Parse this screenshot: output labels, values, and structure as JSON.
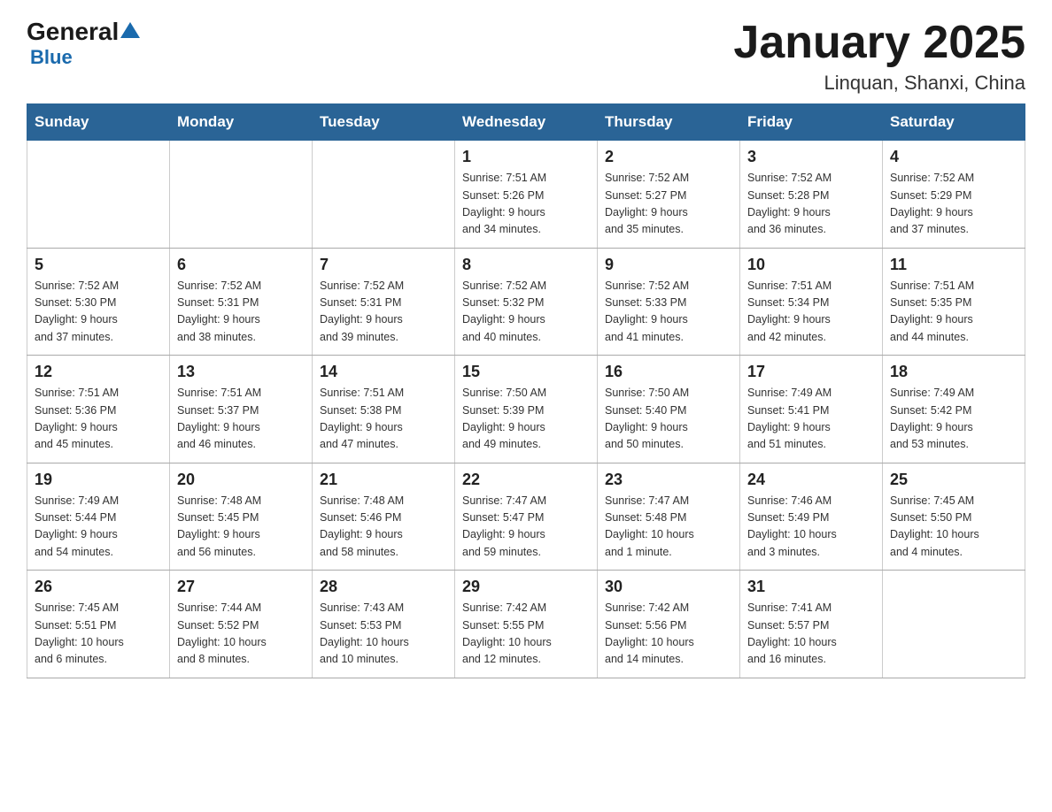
{
  "header": {
    "logo_general": "General",
    "logo_blue": "Blue",
    "month_title": "January 2025",
    "location": "Linquan, Shanxi, China"
  },
  "days_of_week": [
    "Sunday",
    "Monday",
    "Tuesday",
    "Wednesday",
    "Thursday",
    "Friday",
    "Saturday"
  ],
  "weeks": [
    [
      {
        "day": "",
        "info": ""
      },
      {
        "day": "",
        "info": ""
      },
      {
        "day": "",
        "info": ""
      },
      {
        "day": "1",
        "info": "Sunrise: 7:51 AM\nSunset: 5:26 PM\nDaylight: 9 hours\nand 34 minutes."
      },
      {
        "day": "2",
        "info": "Sunrise: 7:52 AM\nSunset: 5:27 PM\nDaylight: 9 hours\nand 35 minutes."
      },
      {
        "day": "3",
        "info": "Sunrise: 7:52 AM\nSunset: 5:28 PM\nDaylight: 9 hours\nand 36 minutes."
      },
      {
        "day": "4",
        "info": "Sunrise: 7:52 AM\nSunset: 5:29 PM\nDaylight: 9 hours\nand 37 minutes."
      }
    ],
    [
      {
        "day": "5",
        "info": "Sunrise: 7:52 AM\nSunset: 5:30 PM\nDaylight: 9 hours\nand 37 minutes."
      },
      {
        "day": "6",
        "info": "Sunrise: 7:52 AM\nSunset: 5:31 PM\nDaylight: 9 hours\nand 38 minutes."
      },
      {
        "day": "7",
        "info": "Sunrise: 7:52 AM\nSunset: 5:31 PM\nDaylight: 9 hours\nand 39 minutes."
      },
      {
        "day": "8",
        "info": "Sunrise: 7:52 AM\nSunset: 5:32 PM\nDaylight: 9 hours\nand 40 minutes."
      },
      {
        "day": "9",
        "info": "Sunrise: 7:52 AM\nSunset: 5:33 PM\nDaylight: 9 hours\nand 41 minutes."
      },
      {
        "day": "10",
        "info": "Sunrise: 7:51 AM\nSunset: 5:34 PM\nDaylight: 9 hours\nand 42 minutes."
      },
      {
        "day": "11",
        "info": "Sunrise: 7:51 AM\nSunset: 5:35 PM\nDaylight: 9 hours\nand 44 minutes."
      }
    ],
    [
      {
        "day": "12",
        "info": "Sunrise: 7:51 AM\nSunset: 5:36 PM\nDaylight: 9 hours\nand 45 minutes."
      },
      {
        "day": "13",
        "info": "Sunrise: 7:51 AM\nSunset: 5:37 PM\nDaylight: 9 hours\nand 46 minutes."
      },
      {
        "day": "14",
        "info": "Sunrise: 7:51 AM\nSunset: 5:38 PM\nDaylight: 9 hours\nand 47 minutes."
      },
      {
        "day": "15",
        "info": "Sunrise: 7:50 AM\nSunset: 5:39 PM\nDaylight: 9 hours\nand 49 minutes."
      },
      {
        "day": "16",
        "info": "Sunrise: 7:50 AM\nSunset: 5:40 PM\nDaylight: 9 hours\nand 50 minutes."
      },
      {
        "day": "17",
        "info": "Sunrise: 7:49 AM\nSunset: 5:41 PM\nDaylight: 9 hours\nand 51 minutes."
      },
      {
        "day": "18",
        "info": "Sunrise: 7:49 AM\nSunset: 5:42 PM\nDaylight: 9 hours\nand 53 minutes."
      }
    ],
    [
      {
        "day": "19",
        "info": "Sunrise: 7:49 AM\nSunset: 5:44 PM\nDaylight: 9 hours\nand 54 minutes."
      },
      {
        "day": "20",
        "info": "Sunrise: 7:48 AM\nSunset: 5:45 PM\nDaylight: 9 hours\nand 56 minutes."
      },
      {
        "day": "21",
        "info": "Sunrise: 7:48 AM\nSunset: 5:46 PM\nDaylight: 9 hours\nand 58 minutes."
      },
      {
        "day": "22",
        "info": "Sunrise: 7:47 AM\nSunset: 5:47 PM\nDaylight: 9 hours\nand 59 minutes."
      },
      {
        "day": "23",
        "info": "Sunrise: 7:47 AM\nSunset: 5:48 PM\nDaylight: 10 hours\nand 1 minute."
      },
      {
        "day": "24",
        "info": "Sunrise: 7:46 AM\nSunset: 5:49 PM\nDaylight: 10 hours\nand 3 minutes."
      },
      {
        "day": "25",
        "info": "Sunrise: 7:45 AM\nSunset: 5:50 PM\nDaylight: 10 hours\nand 4 minutes."
      }
    ],
    [
      {
        "day": "26",
        "info": "Sunrise: 7:45 AM\nSunset: 5:51 PM\nDaylight: 10 hours\nand 6 minutes."
      },
      {
        "day": "27",
        "info": "Sunrise: 7:44 AM\nSunset: 5:52 PM\nDaylight: 10 hours\nand 8 minutes."
      },
      {
        "day": "28",
        "info": "Sunrise: 7:43 AM\nSunset: 5:53 PM\nDaylight: 10 hours\nand 10 minutes."
      },
      {
        "day": "29",
        "info": "Sunrise: 7:42 AM\nSunset: 5:55 PM\nDaylight: 10 hours\nand 12 minutes."
      },
      {
        "day": "30",
        "info": "Sunrise: 7:42 AM\nSunset: 5:56 PM\nDaylight: 10 hours\nand 14 minutes."
      },
      {
        "day": "31",
        "info": "Sunrise: 7:41 AM\nSunset: 5:57 PM\nDaylight: 10 hours\nand 16 minutes."
      },
      {
        "day": "",
        "info": ""
      }
    ]
  ]
}
